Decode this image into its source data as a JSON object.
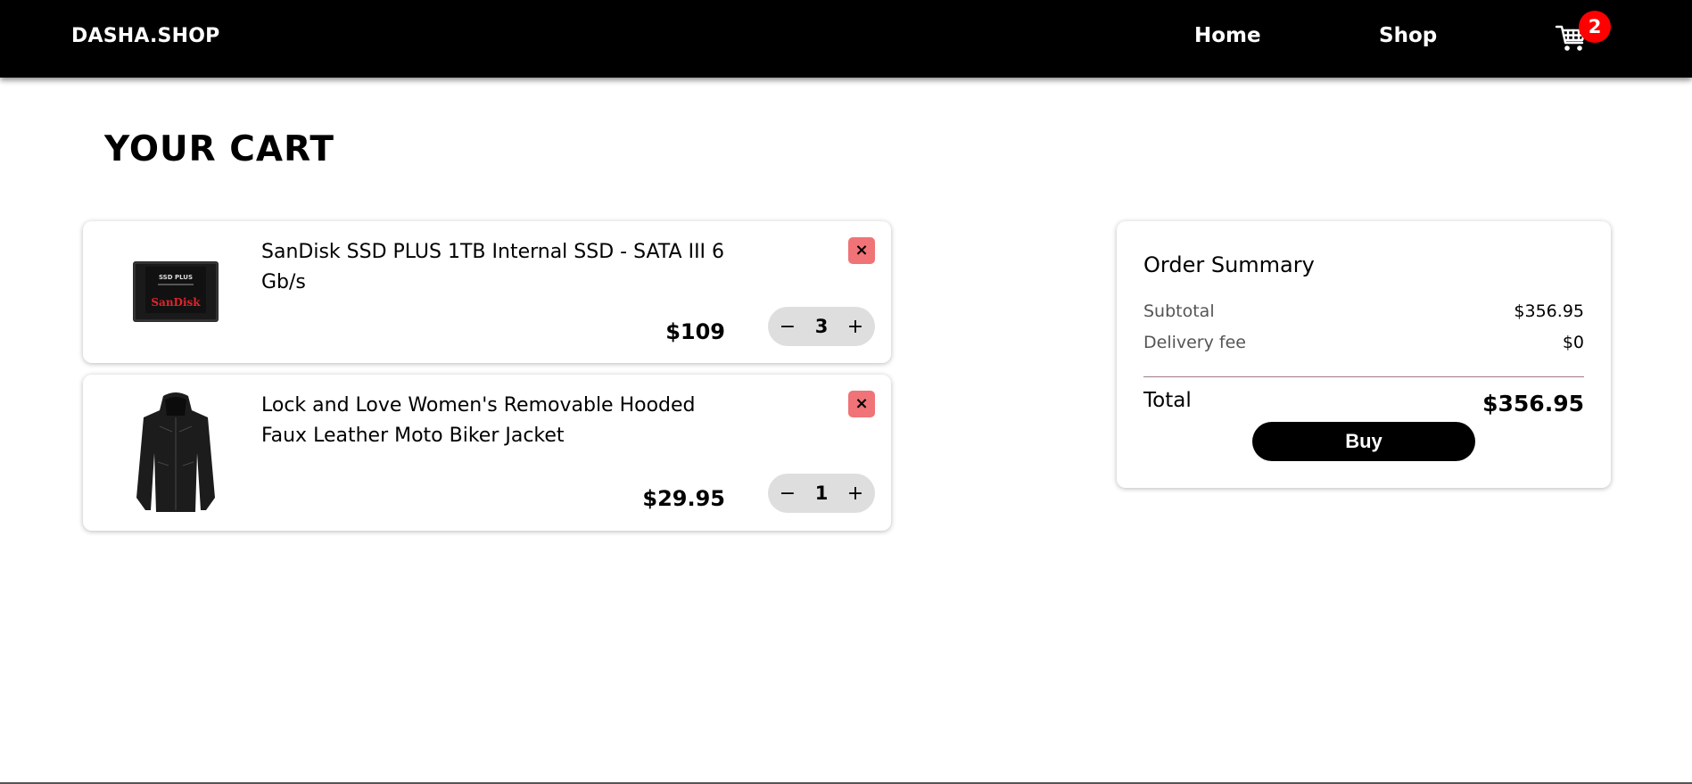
{
  "header": {
    "brand": "DASHA.SHOP",
    "nav": [
      {
        "label": "Home"
      },
      {
        "label": "Shop"
      }
    ],
    "cart_icon": "cart-icon",
    "cart_count": "2",
    "badge_color": "#ff0000"
  },
  "page": {
    "title": "YOUR CART"
  },
  "cart": {
    "items": [
      {
        "title": "SanDisk SSD PLUS 1TB Internal SSD - SATA III 6 Gb/s",
        "price": "$109",
        "quantity": "3",
        "image": "ssd-image",
        "remove_label": "×",
        "minus_label": "−",
        "plus_label": "+"
      },
      {
        "title": "Lock and Love Women's Removable Hooded Faux Leather Moto Biker Jacket",
        "price": "$29.95",
        "quantity": "1",
        "image": "jacket-image",
        "remove_label": "×",
        "minus_label": "−",
        "plus_label": "+"
      }
    ]
  },
  "summary": {
    "title": "Order Summary",
    "subtotal_label": "Subtotal",
    "subtotal_value": "$356.95",
    "delivery_label": "Delivery fee",
    "delivery_value": "$0",
    "total_label": "Total",
    "total_value": "$356.95",
    "buy_label": "Buy"
  },
  "colors": {
    "header_bg": "#000000",
    "remove_bg": "#f07377",
    "stepper_bg": "#dedede"
  }
}
